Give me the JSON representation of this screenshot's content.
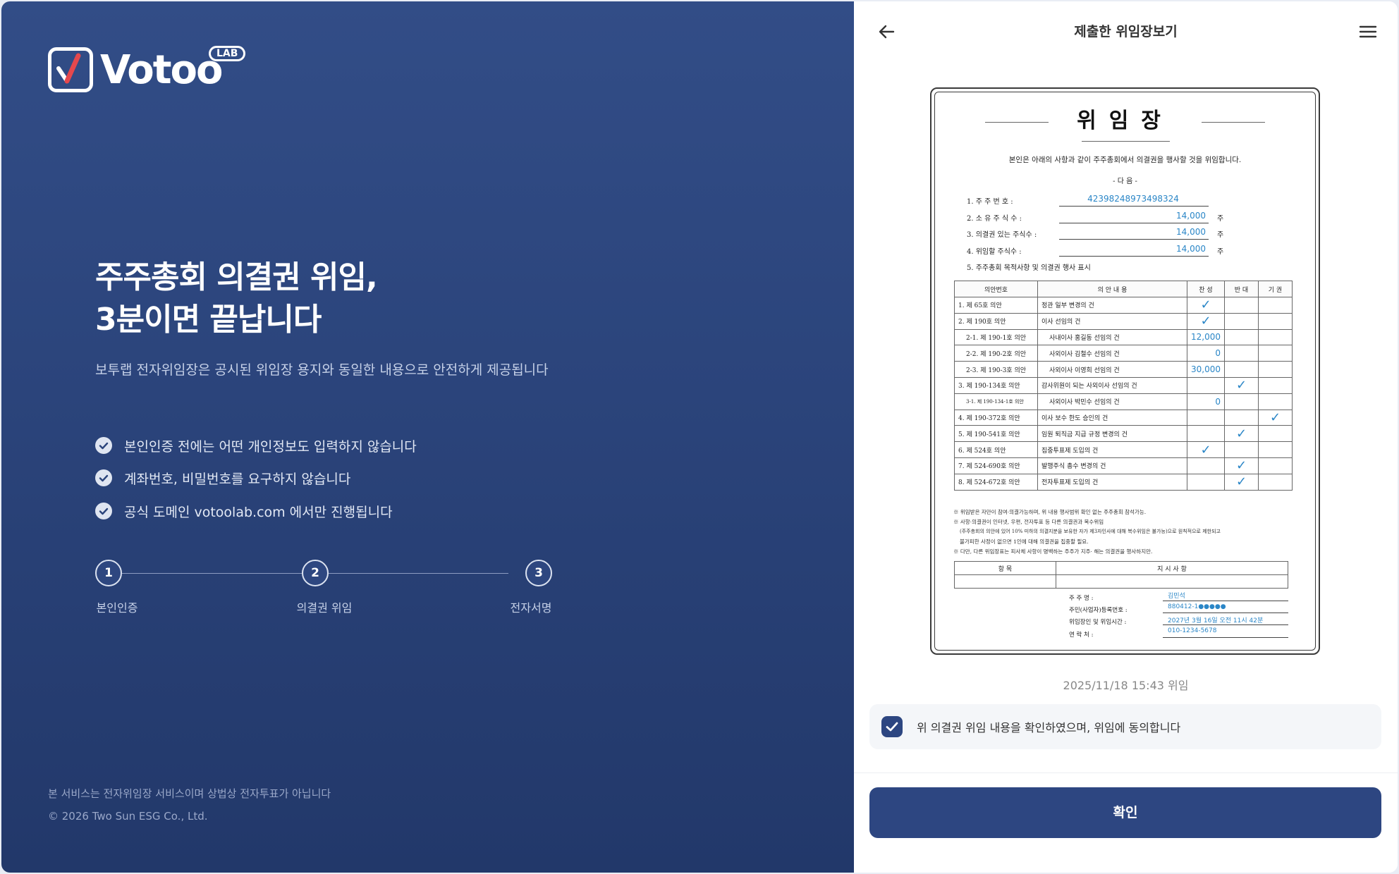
{
  "brand": {
    "name": "Votoo",
    "badge": "LAB"
  },
  "hero": {
    "line1": "주주총회 의결권 위임,",
    "line2": "3분이면 끝납니다"
  },
  "description": "보투랩 전자위임장은 공시된 위임장 용지와 동일한 내용으로 안전하게 제공됩니다",
  "bullets": [
    "본인인증 전에는 어떤 개인정보도 입력하지 않습니다",
    "계좌번호, 비밀번호를 요구하지 않습니다",
    "공식 도메인 votoolab.com 에서만 진행됩니다"
  ],
  "steps": [
    {
      "number": "1",
      "label": "본인인증"
    },
    {
      "number": "2",
      "label": "의결권 위임"
    },
    {
      "number": "3",
      "label": "전자서명"
    }
  ],
  "footer": {
    "notice": "본 서비스는 전자위임장 서비스이며 상법상 전자투표가 아닙니다",
    "copyright": "© 2026 Two Sun ESG Co., Ltd."
  },
  "header": {
    "title": "제출한 위임장보기",
    "back_icon": "arrow-left-icon",
    "menu_icon": "hamburger-menu-icon"
  },
  "proxy_doc": {
    "title": "위임장",
    "intro": "본인은 아래의 사항과 같이 주주총회에서 의결권을 행사할 것을 위임합니다.",
    "da_eum": "- 다 음 -",
    "fields": [
      {
        "label": "1. 주 주 번 호 :",
        "value": "423982489734983​24",
        "unit": ""
      },
      {
        "label": "2. 소 유 주 식 수 :",
        "value": "14,000",
        "unit": "주"
      },
      {
        "label": "3. 의결권 있는 주식수 :",
        "value": "14,000",
        "unit": "주"
      },
      {
        "label": "4. 위임할 주식수 :",
        "value": "14,000",
        "unit": "주"
      }
    ],
    "section5": "5. 주주총회 목적사항 및 의결권 행사 표시",
    "table_headers": [
      "의안번호",
      "의 안 내 용",
      "찬 성",
      "반 대",
      "기 권"
    ],
    "rows": [
      {
        "no": "1. 제 65호 의안",
        "content": "정관 일부 변경의 건",
        "for": "✓",
        "against": "",
        "abstain": ""
      },
      {
        "no": "2. 제 190호 의안",
        "content": "이사 선임의 건",
        "for": "✓",
        "against": "",
        "abstain": ""
      },
      {
        "no": "2-1. 제 190-1호 의안",
        "content": "사내이사 홍길동 선임의 건",
        "for": "12,000",
        "against": "",
        "abstain": ""
      },
      {
        "no": "2-2. 제 190-2호 의안",
        "content": "사외이사 김철수 선임의 건",
        "for": "0",
        "against": "",
        "abstain": ""
      },
      {
        "no": "2-3. 제 190-3호 의안",
        "content": "사외이사 이영희 선임의 건",
        "for": "30,000",
        "against": "",
        "abstain": ""
      },
      {
        "no": "3. 제 190-134호 의안",
        "content": "감사위원이 되는 사외이사 선임의 건",
        "for": "",
        "against": "✓",
        "abstain": ""
      },
      {
        "no": "3-1. 제 190-134-1호 의안",
        "content": "사외이사 박민수 선임의 건",
        "for": "0",
        "against": "",
        "abstain": ""
      },
      {
        "no": "4. 제 190-372호 의안",
        "content": "이사 보수 한도 승인의 건",
        "for": "",
        "against": "",
        "abstain": "✓"
      },
      {
        "no": "5. 제 190-541호 의안",
        "content": "임원 퇴직금 지급 규정 변경의 건",
        "for": "",
        "against": "✓",
        "abstain": ""
      },
      {
        "no": "6. 제 524호 의안",
        "content": "집중투표제 도입의 건",
        "for": "✓",
        "against": "",
        "abstain": ""
      },
      {
        "no": "7. 제 524-690호 의안",
        "content": "발행주식 총수 변경의 건",
        "for": "",
        "against": "✓",
        "abstain": ""
      },
      {
        "no": "8. 제 524-672호 의안",
        "content": "전자투표제 도입의 건",
        "for": "",
        "against": "✓",
        "abstain": ""
      }
    ],
    "notes": [
      "※ 위임받은 자만이 참여·의결가능하며, 위 내용 행사범위 확인 없는 주주총회 참석가능.",
      "※ 사항·의결권이 인터넷, 우편, 전자투표 등 다른 의결권과 복수위임",
      "(주주총회의 의안에 있어 10% 미하의 의결지분을 보유한 자가 제3자인사에 대해 복수위임은 불가능)으로 원칙적으로 제한되고",
      "불가피한 사정이 없으면 1인에 대해 의결권을 집중할 필요.",
      "※ 다만, 다른 위임장표는 피사체 사항이 명백하는 주주가 지주· 해는 의결권을 행사하지만."
    ],
    "instruction_headers": [
      "항 목",
      "지 시 사 항"
    ],
    "signature": [
      {
        "label": "주 주 명 :",
        "value": "김민석"
      },
      {
        "label": "주민(사업자)등록번호 :",
        "value": "880412-1●●●●●"
      },
      {
        "label": "위임장인 및 위임시간 :",
        "value": "2027년 3월 16일 오전 11시 42분"
      },
      {
        "label": "연 락 처 :",
        "value": "010-1234-5678"
      }
    ]
  },
  "submitted_at": "2025/11/18 15:43 위임",
  "agreement": {
    "text": "위 의결권 위임 내용을 확인하였으며, 위임에 동의합니다",
    "checked": true
  },
  "confirm_button": "확인",
  "colors": {
    "left_bg": "#2b447b",
    "primary": "#2d4681",
    "fill_blue": "#2a86c7"
  }
}
